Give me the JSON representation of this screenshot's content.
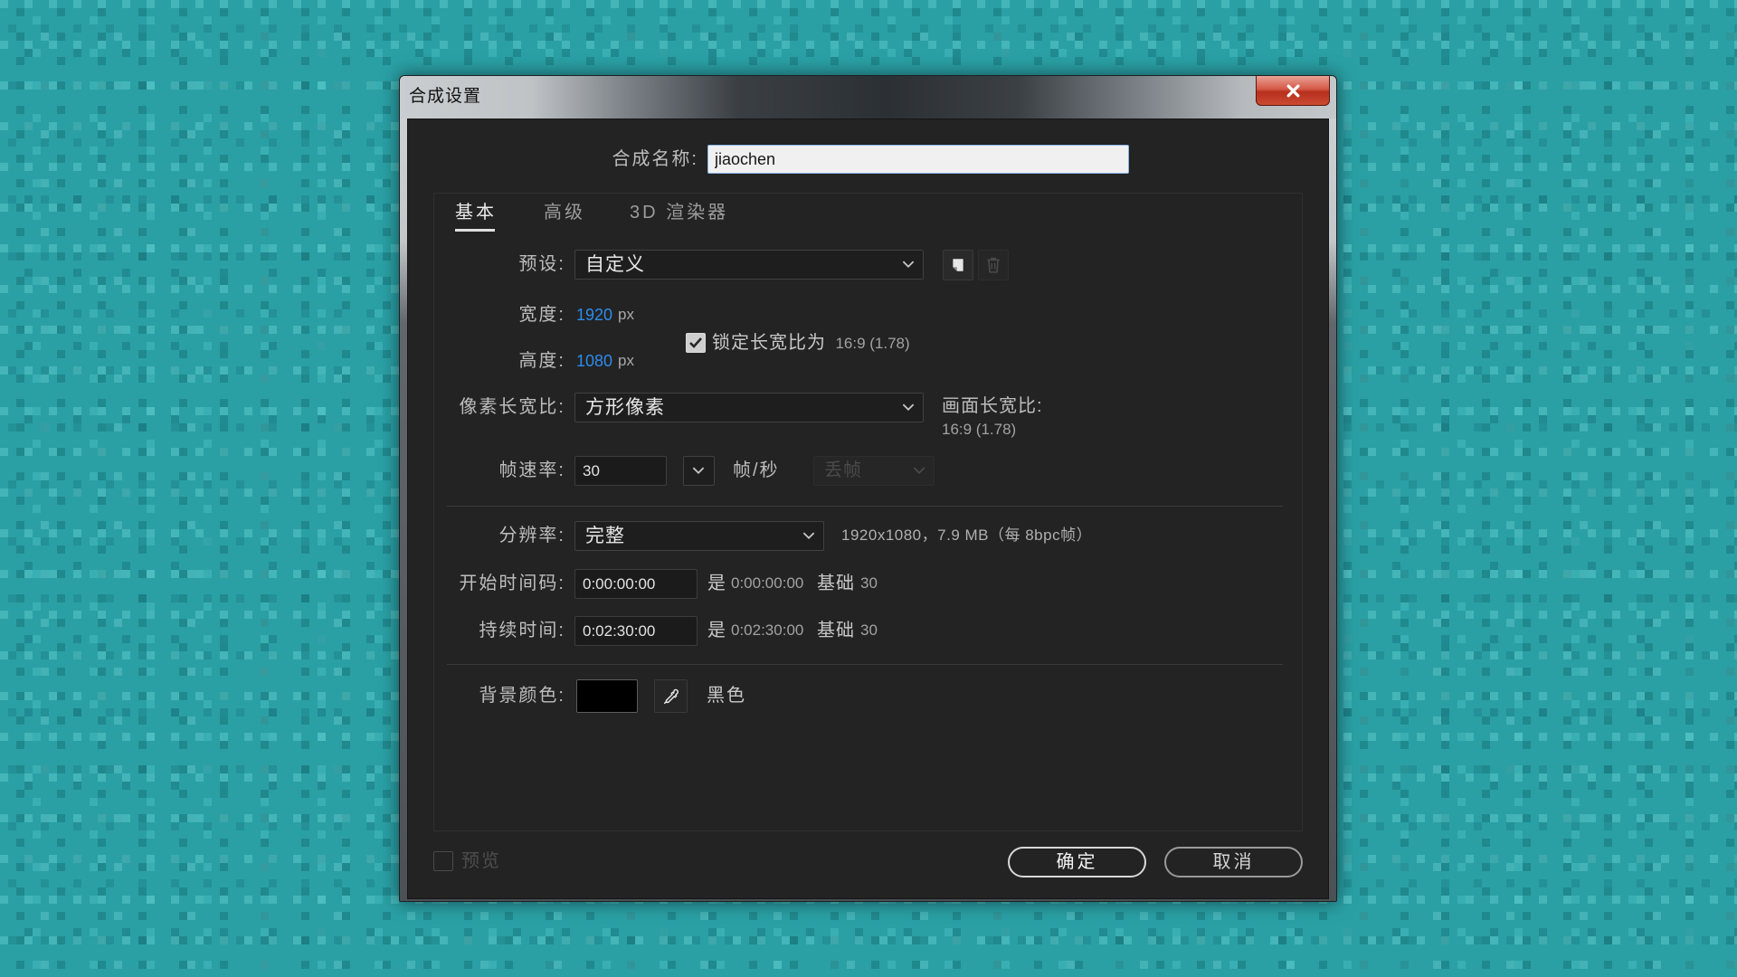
{
  "window": {
    "title": "合成设置"
  },
  "composition_name": {
    "label": "合成名称:",
    "value": "jiaochen"
  },
  "tabs": [
    {
      "label": "基本",
      "active": true
    },
    {
      "label": "高级",
      "active": false
    },
    {
      "label": "3D 渲染器",
      "active": false
    }
  ],
  "basic": {
    "preset": {
      "label": "预设:",
      "value": "自定义"
    },
    "width": {
      "label": "宽度:",
      "value": "1920",
      "unit": "px"
    },
    "height": {
      "label": "高度:",
      "value": "1080",
      "unit": "px"
    },
    "lock_aspect": {
      "checked": true,
      "label": "锁定长宽比为",
      "ratio": "16:9 (1.78)"
    },
    "pixel_aspect": {
      "label": "像素长宽比:",
      "value": "方形像素"
    },
    "frame_aspect": {
      "label": "画面长宽比:",
      "value": "16:9 (1.78)"
    },
    "frame_rate": {
      "label": "帧速率:",
      "value": "30",
      "unit": "帧/秒",
      "drop_frame": "丢帧",
      "drop_frame_enabled": false
    },
    "resolution": {
      "label": "分辨率:",
      "value": "完整",
      "info": "1920x1080，7.9 MB（每 8bpc帧）"
    },
    "start_timecode": {
      "label": "开始时间码:",
      "value": "0:00:00:00",
      "is_label": "是",
      "equivalent": "0:00:00:00",
      "base_label": "基础",
      "base": "30"
    },
    "duration": {
      "label": "持续时间:",
      "value": "0:02:30:00",
      "is_label": "是",
      "equivalent": "0:02:30:00",
      "base_label": "基础",
      "base": "30"
    },
    "background_color": {
      "label": "背景颜色:",
      "swatch": "#000000",
      "name": "黑色"
    }
  },
  "footer": {
    "preview": {
      "label": "预览",
      "checked": false,
      "enabled": false
    },
    "ok_label": "确定",
    "cancel_label": "取消"
  },
  "icons": {
    "close": "close-icon",
    "dropdown": "chevron-down-icon",
    "new_preset": "new-preset-icon",
    "delete_preset": "trash-icon",
    "checkbox": "check-icon",
    "eyedropper": "eyedropper-icon"
  },
  "colors": {
    "accent": "#2d8ceb",
    "desktop_background": "#2aa0a5",
    "close_button": "#c8412d"
  }
}
